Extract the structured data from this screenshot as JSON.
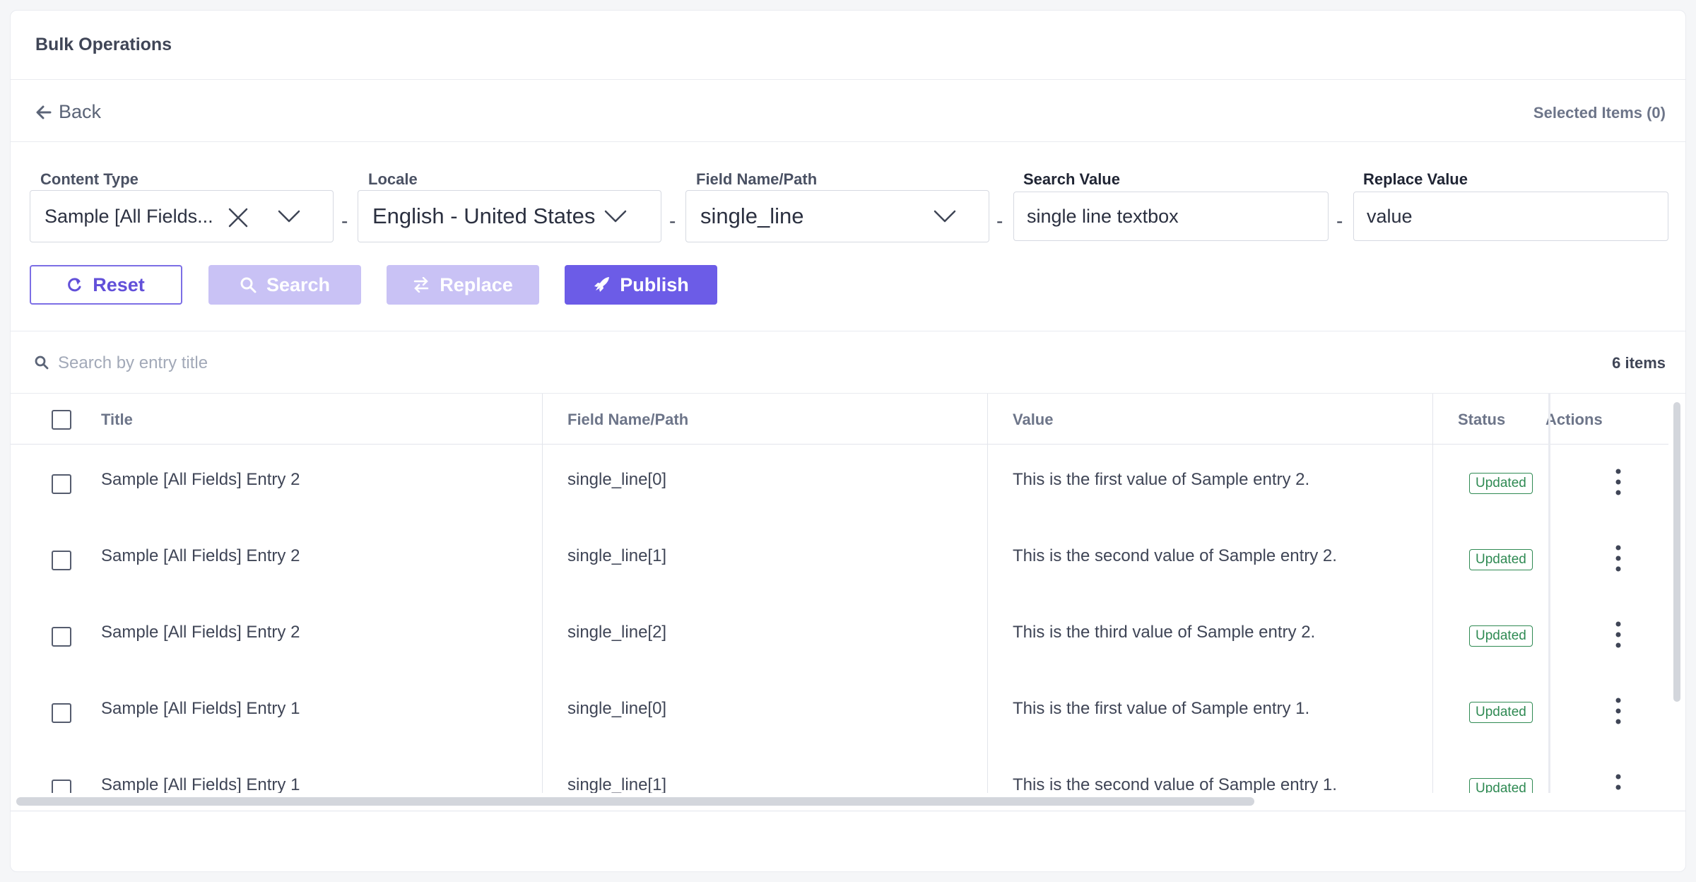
{
  "header": {
    "title": "Bulk Operations"
  },
  "subbar": {
    "back_label": "Back",
    "selected_items": "Selected Items (0)"
  },
  "filters": {
    "content_type": {
      "label": "Content Type",
      "value": "Sample [All Fields..."
    },
    "locale": {
      "label": "Locale",
      "value": "English - United States"
    },
    "field_path": {
      "label": "Field Name/Path",
      "value": "single_line"
    },
    "search_value": {
      "label": "Search Value",
      "value": "single line textbox"
    },
    "replace_value": {
      "label": "Replace Value",
      "value": "value"
    },
    "separator": "-"
  },
  "buttons": {
    "reset": "Reset",
    "search": "Search",
    "replace": "Replace",
    "publish": "Publish"
  },
  "entry_search": {
    "placeholder": "Search by entry title",
    "count": "6 items"
  },
  "table": {
    "headers": {
      "title": "Title",
      "field": "Field Name/Path",
      "value": "Value",
      "status": "Status",
      "actions": "Actions"
    },
    "rows": [
      {
        "title": "Sample [All Fields] Entry 2",
        "field": "single_line[0]",
        "value": "This is the first value of Sample entry 2.",
        "status": "Updated"
      },
      {
        "title": "Sample [All Fields] Entry 2",
        "field": "single_line[1]",
        "value": "This is the second value of Sample entry 2.",
        "status": "Updated"
      },
      {
        "title": "Sample [All Fields] Entry 2",
        "field": "single_line[2]",
        "value": "This is the third value of Sample entry 2.",
        "status": "Updated"
      },
      {
        "title": "Sample [All Fields] Entry 1",
        "field": "single_line[0]",
        "value": "This is the first value of Sample entry 1.",
        "status": "Updated"
      },
      {
        "title": "Sample [All Fields] Entry 1",
        "field": "single_line[1]",
        "value": "This is the second value of Sample entry 1.",
        "status": "Updated"
      }
    ]
  },
  "colors": {
    "accent": "#6c5ce7",
    "accent_disabled": "#c9c2f5",
    "status_green": "#2f8a53"
  }
}
